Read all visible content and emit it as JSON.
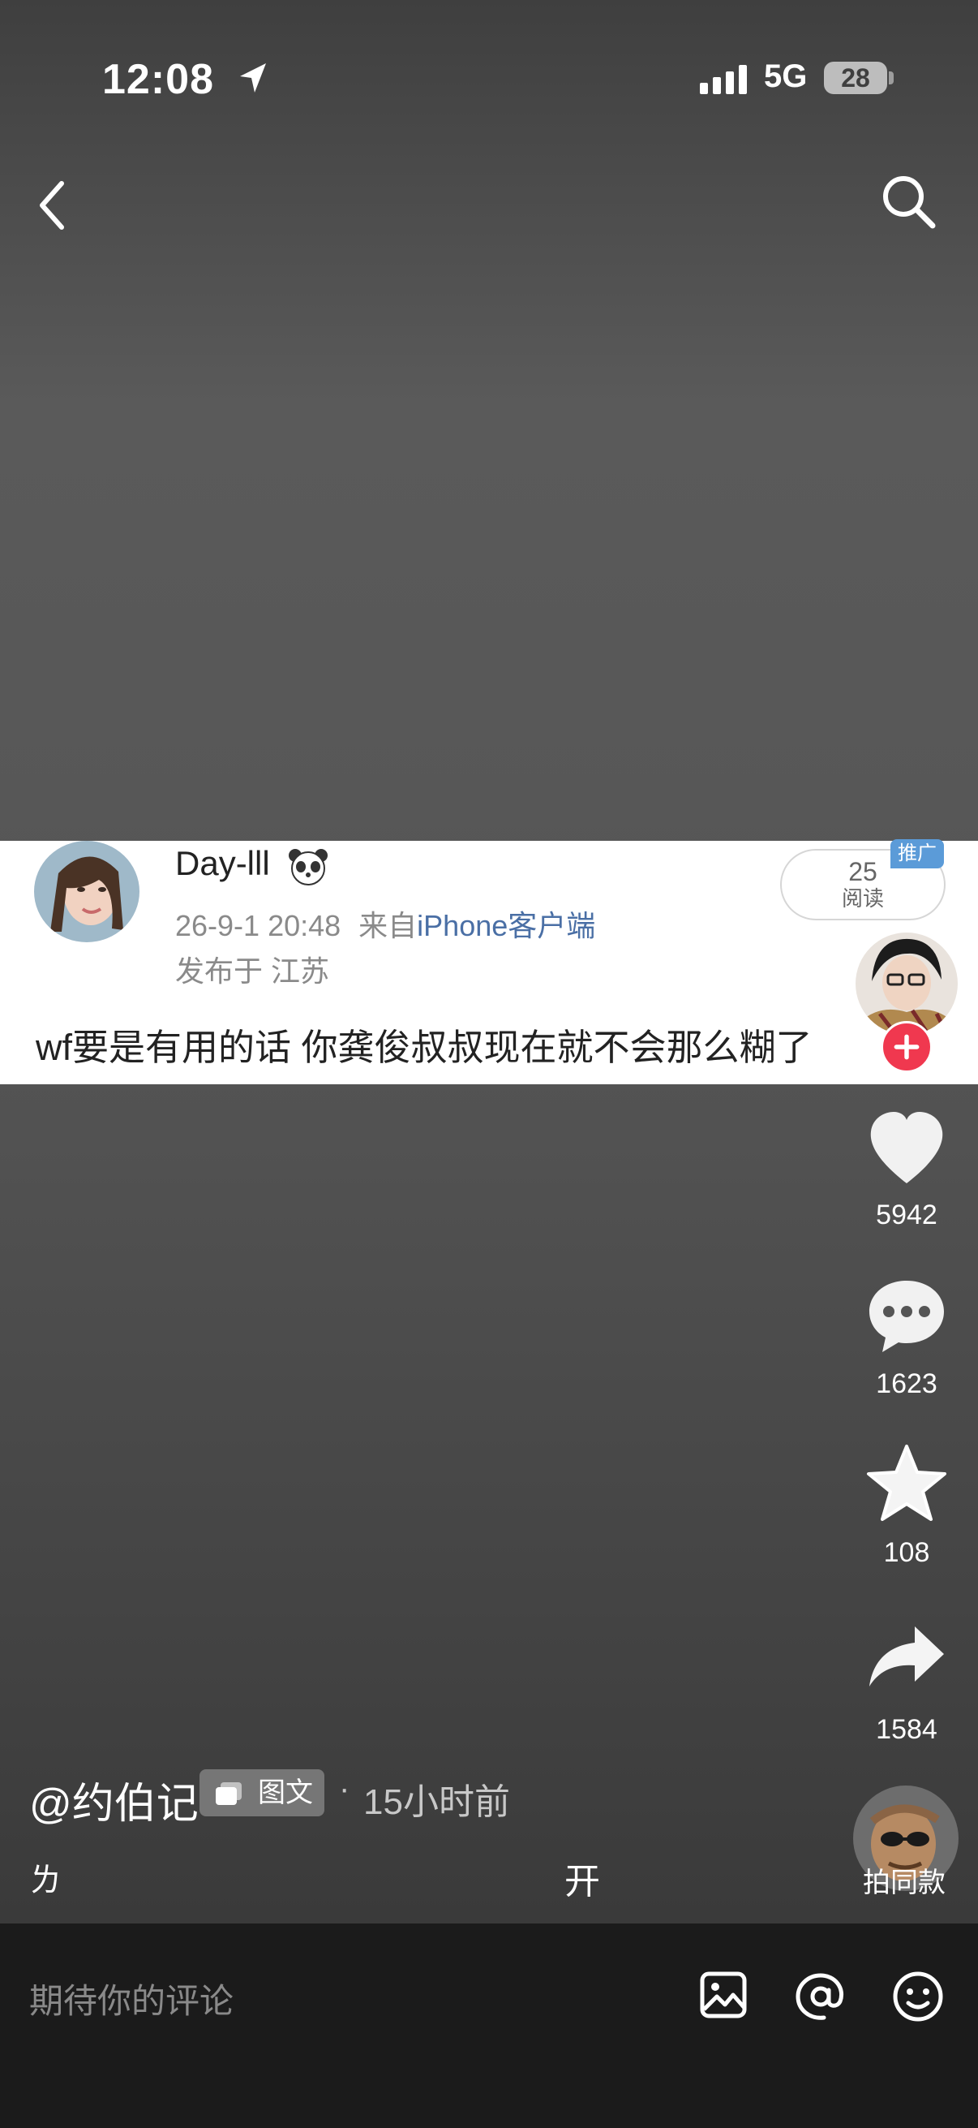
{
  "status": {
    "time": "12:08",
    "network": "5G",
    "battery": "28"
  },
  "post": {
    "username": "Day-lll",
    "datetime": "26-9-1 20:48",
    "source_label": "来自",
    "source_name": "iPhone客户端",
    "location": "发布于 江苏",
    "text": "wf要是有用的话 你龚俊叔叔现在就不会那么糊了",
    "reads_count": "25",
    "reads_label": "阅读",
    "promo_tag": "推广"
  },
  "actions": {
    "likes": "5942",
    "comments": "1623",
    "favorites": "108",
    "shares": "1584"
  },
  "caption": {
    "author": "@约伯记",
    "type_chip": "图文",
    "separator": "·",
    "time_ago": "15小时前",
    "fragment_left": "ㄌ",
    "fragment_center": "开",
    "same_style": "拍同款"
  },
  "comment_bar": {
    "placeholder": "期待你的评论"
  },
  "colors": {
    "follow_red": "#f0384f",
    "link_blue": "#4a6fa5",
    "promo_blue": "#5b9bd8"
  }
}
